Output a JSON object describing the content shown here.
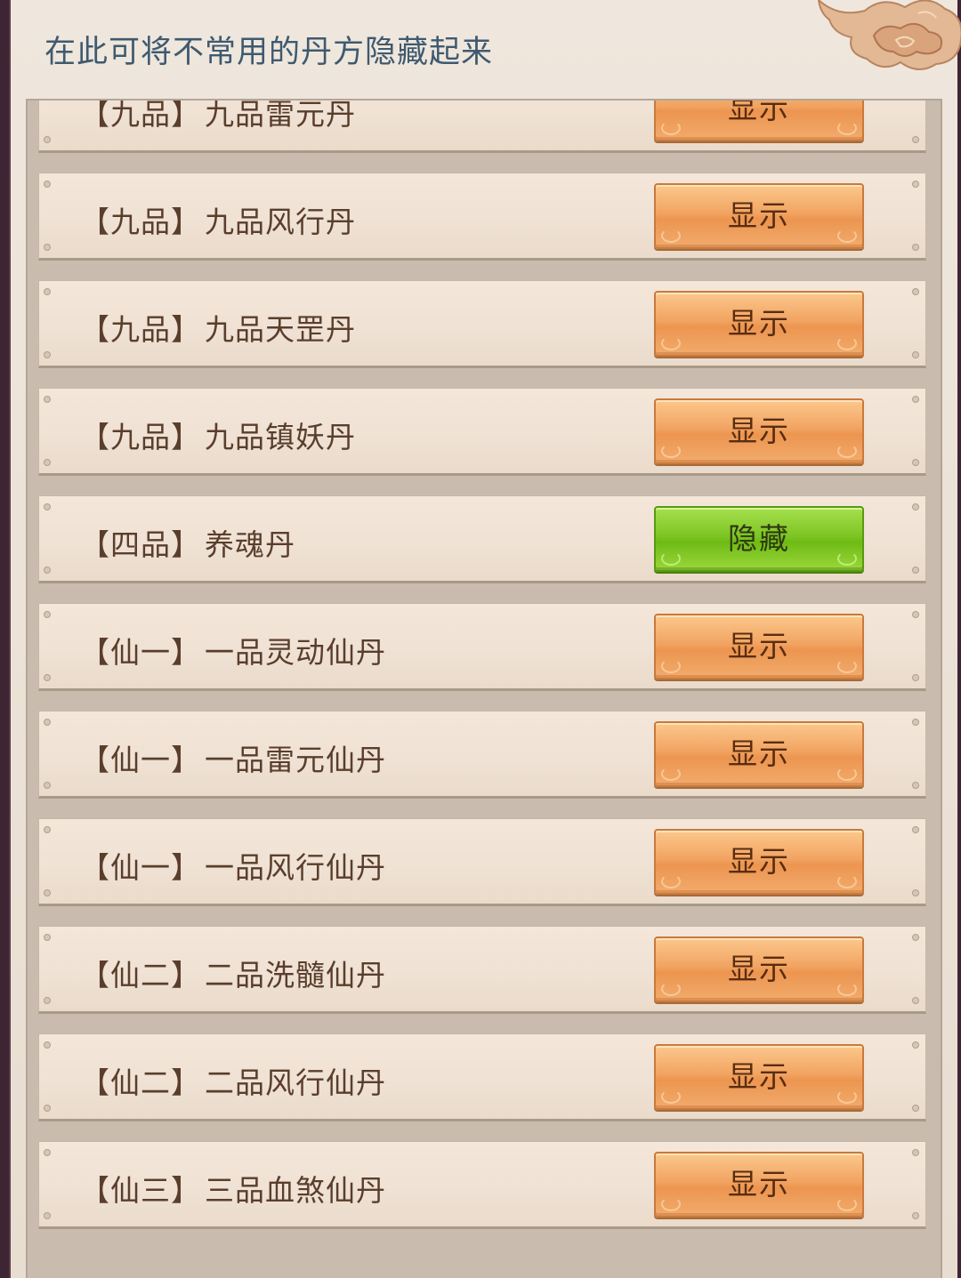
{
  "header": {
    "title": "在此可将不常用的丹方隐藏起来"
  },
  "colors": {
    "show_button": "#f2a462",
    "hide_button": "#7ec524",
    "title_text": "#3f5a70",
    "row_text": "#5a3e2c"
  },
  "rows": [
    {
      "grade": "【九品】",
      "name": "九品雷元丹",
      "button": "显示",
      "state": "show"
    },
    {
      "grade": "【九品】",
      "name": "九品风行丹",
      "button": "显示",
      "state": "show"
    },
    {
      "grade": "【九品】",
      "name": "九品天罡丹",
      "button": "显示",
      "state": "show"
    },
    {
      "grade": "【九品】",
      "name": "九品镇妖丹",
      "button": "显示",
      "state": "show"
    },
    {
      "grade": "【四品】",
      "name": "养魂丹",
      "button": "隐藏",
      "state": "hide"
    },
    {
      "grade": "【仙一】",
      "name": "一品灵动仙丹",
      "button": "显示",
      "state": "show"
    },
    {
      "grade": "【仙一】",
      "name": "一品雷元仙丹",
      "button": "显示",
      "state": "show"
    },
    {
      "grade": "【仙一】",
      "name": "一品风行仙丹",
      "button": "显示",
      "state": "show"
    },
    {
      "grade": "【仙二】",
      "name": "二品洗髓仙丹",
      "button": "显示",
      "state": "show"
    },
    {
      "grade": "【仙二】",
      "name": "二品风行仙丹",
      "button": "显示",
      "state": "show"
    },
    {
      "grade": "【仙三】",
      "name": "三品血煞仙丹",
      "button": "显示",
      "state": "show"
    }
  ]
}
